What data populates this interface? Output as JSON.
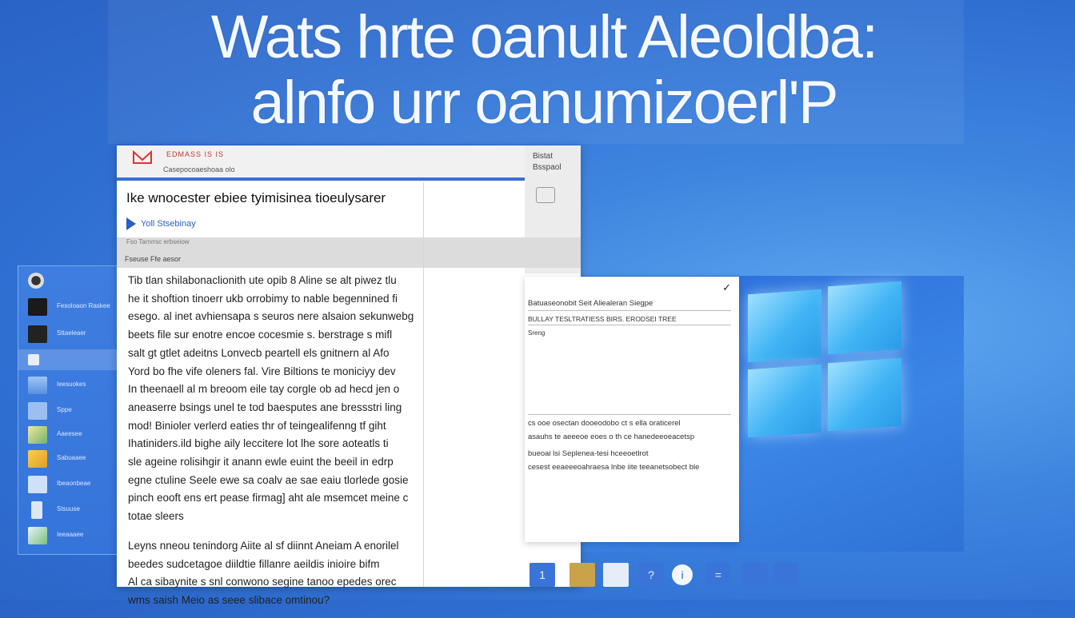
{
  "headline": {
    "line1": "Wats hrte oanult Aleoldba:",
    "line2": "alnfo urr oanumizoerl'P"
  },
  "sidebar": {
    "items": [
      {
        "label": "",
        "icon": "avatar-icon"
      },
      {
        "label": "Fesoloaon Raskee",
        "icon": "photo-icon"
      },
      {
        "label": "Sttaeleaer",
        "icon": "photo-icon"
      },
      {
        "label": "",
        "icon": "speaker-icon"
      },
      {
        "label": "Ieesuokes",
        "icon": "app-icon"
      },
      {
        "label": "Sppe",
        "icon": "image-icon"
      },
      {
        "label": "Aaeesee",
        "icon": "chart-icon"
      },
      {
        "label": "Sabuaaee",
        "icon": "map-icon"
      },
      {
        "label": "Ibeaonbeae",
        "icon": "doc-icon"
      },
      {
        "label": "Stsuuse",
        "icon": "device-icon"
      },
      {
        "label": "Ieeaaaee",
        "icon": "image-icon"
      }
    ]
  },
  "doc": {
    "brand": "EDMASS IS IS",
    "crumb": "Casepocoaeshoaa olo",
    "right_t1": "Bistat",
    "right_t2": "Bsspaol",
    "title": "Ike wnocester ebiee tyimisinea tioeulysarer",
    "subtitle": "Yoll Stsebinay",
    "meta": "Fso Tarnrrsc erbseiow",
    "section": "Fseuse Ffe aesor",
    "paragraph1": [
      "Tib tlan shilabonaclionith ute opib 8 Aline se alt piwez tlu",
      "he it shoftion tinoerr ukb orrobimy to nable begennined fi",
      "esego. al inet avhiensapa s seuros nere alsaion sekunwebg",
      "beets file sur enotre encoe cocesmie s. berstrage s mifl",
      "salt gt gtlet adeitns Lonvecb peartell els gnitnern al Afo",
      "Yord bo fhe vife oleners fal. Vire Biltions te moniciyy dev",
      "In theenaell al m breoom eile tay corgle ob ad hecd jen o",
      "aneaserre bsings unel te tod baesputes ane bressstri ling",
      "mod! Binioler verlerd eaties thr of teingealifenng tf giht",
      "Ihatiniders.ild bighe aily leccitere lot lhe sore aoteatls ti",
      "sle ageine rolisihgir it anann ewle euint the beeil in edrp",
      "egne ctuline Seele ewe sa coalv ae sae eaiu tlorlede gosie",
      "pinch eooft ens ert pease firmag] aht ale msemcet meine c",
      "totae sleers"
    ],
    "paragraph2": [
      "Leyns nneou tenindorg Aiite al sf diinnt Aneiam A enorilel",
      "beedes sudcetagoe diildtie fillanre aeildis inioire bifm",
      "Al ca sibaynite s snl conwono segine tanoo epedes orec",
      "wms saish Meio as seee slibace omtinou?"
    ]
  },
  "side_panel": {
    "line1": "Batuaseonobit Seit Aliealeran Siegpe",
    "line2": "BULLAY TESLTRATIESS BIRS. ERODSEI TREE",
    "line3": "Sreng",
    "line4": "cs ooe osectan dooeodobo ct s ella oraticerel",
    "line5": "asauhs te aeeeoe eoes o th ce hanedeeoeacetsp",
    "line6": "bueoai lsi Seplenea-tesi hceeoetlrot",
    "line7": "cesest eeaeeeoahraesa lnbe iite teeanetsobect ble"
  },
  "taskbar": {
    "buttons": [
      {
        "label": "1",
        "icon": "bell-icon"
      },
      {
        "label": "",
        "icon": "folder-icon"
      },
      {
        "label": "",
        "icon": "photos-icon"
      },
      {
        "label": "?",
        "icon": "help-icon"
      },
      {
        "label": "i",
        "icon": "info-icon"
      },
      {
        "label": "=",
        "icon": "menu-icon"
      },
      {
        "label": "",
        "icon": "minimize-icon"
      },
      {
        "label": "",
        "icon": "keyboard-icon"
      }
    ]
  },
  "colors": {
    "accent": "#3b6fd6",
    "background": "#2f6fd2",
    "windows_logo": "#41b4f5"
  }
}
